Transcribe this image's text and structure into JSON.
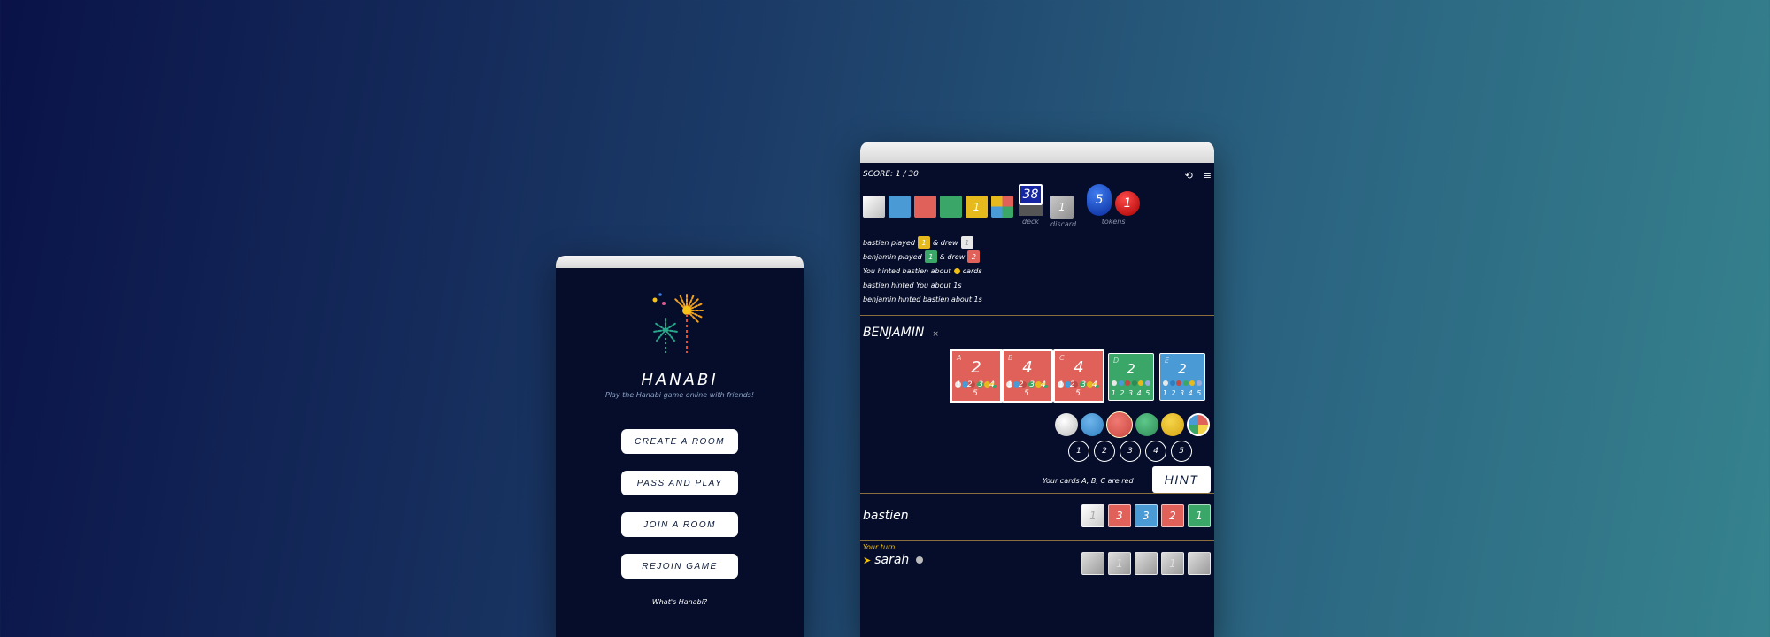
{
  "menu": {
    "title": "HANABI",
    "subtitle": "Play the Hanabi game online with friends!",
    "buttons": [
      "CREATE A ROOM",
      "PASS AND PLAY",
      "JOIN A ROOM",
      "REJOIN GAME"
    ],
    "footer_link": "What's Hanabi?"
  },
  "game": {
    "score": "SCORE: 1 / 30",
    "stacks": [
      {
        "color": "#e3e3e3",
        "value": ""
      },
      {
        "color": "#4a9ad6",
        "value": ""
      },
      {
        "color": "#e0605a",
        "value": ""
      },
      {
        "color": "#3aa668",
        "value": ""
      },
      {
        "color": "#e6b91c",
        "value": "1"
      },
      {
        "color": "multi",
        "value": ""
      }
    ],
    "deck": {
      "count": "38",
      "label": "deck"
    },
    "discard": {
      "value": "1",
      "label": "discard"
    },
    "tokens": {
      "blue": "5",
      "red": "1",
      "label": "tokens"
    },
    "log": {
      "l1a": "bastien played",
      "l1b": "& drew",
      "l1c1": "1",
      "l1c2": "1",
      "l2a": "benjamin played",
      "l2b": "& drew",
      "l2c1": "1",
      "l2c2": "2",
      "l3a": "You hinted bastien about",
      "l3b": "cards",
      "l4": "bastien hinted You about 1s",
      "l5": "benjamin hinted bastien about 1s"
    },
    "benjamin": {
      "name": "BENJAMIN",
      "close": "×",
      "cards": [
        {
          "letter": "A",
          "value": "2",
          "color": "#e0605a",
          "nums": "1 2 3 4 5"
        },
        {
          "letter": "B",
          "value": "4",
          "color": "#e0605a",
          "nums": "1 2 3 4 5"
        },
        {
          "letter": "C",
          "value": "4",
          "color": "#e0605a",
          "nums": "1 2 3 4 5"
        },
        {
          "letter": "D",
          "value": "2",
          "color": "#3aa668",
          "nums": "1 2 3 4 5"
        },
        {
          "letter": "E",
          "value": "2",
          "color": "#4a9ad6",
          "nums": "1 2 3 4 5"
        }
      ],
      "hint_numbers": [
        "1",
        "2",
        "3",
        "4",
        "5"
      ],
      "hint_message": "Your cards A, B, C are red",
      "hint_button": "HINT"
    },
    "bastien": {
      "name": "bastien",
      "cards": [
        {
          "value": "1",
          "color": "#e8e8e8"
        },
        {
          "value": "3",
          "color": "#e0605a"
        },
        {
          "value": "3",
          "color": "#4a9ad6"
        },
        {
          "value": "2",
          "color": "#e0605a"
        },
        {
          "value": "1",
          "color": "#3aa668"
        }
      ]
    },
    "sarah": {
      "turn_label": "Your turn",
      "marker": "➤",
      "name": "sarah",
      "cards": [
        "",
        "1",
        "",
        "1",
        ""
      ]
    }
  }
}
